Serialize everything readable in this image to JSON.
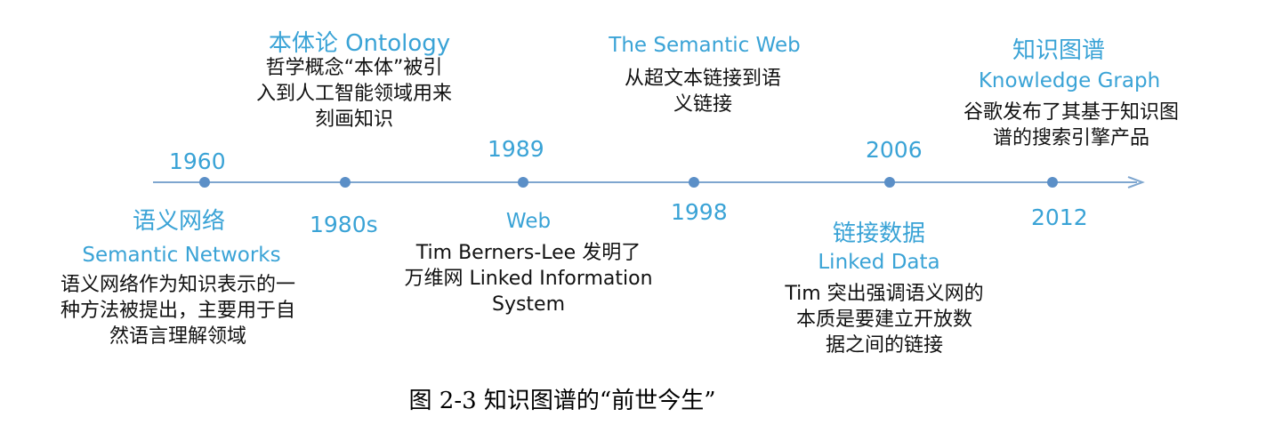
{
  "timeline": {
    "axis_color": "#7ea6cf",
    "dot_color": "#5b8fc7",
    "text_color": "#3aa3d6",
    "events": [
      {
        "year": "1960",
        "title_zh": "语义网络",
        "title_en": "Semantic Networks",
        "desc": [
          "语义网络作为知识表示的一",
          "种方法被提出，主要用于自",
          "然语言理解领域"
        ]
      },
      {
        "year": "1980s",
        "title_zh": "本体论 Ontology",
        "title_en": "",
        "desc": [
          "哲学概念“本体”被引",
          "入到人工智能领域用来",
          "刻画知识"
        ]
      },
      {
        "year": "1989",
        "title_zh": "",
        "title_en": "Web",
        "desc": [
          "Tim Berners-Lee 发明了",
          "万维网 Linked Information",
          "System"
        ]
      },
      {
        "year": "1998",
        "title_zh": "",
        "title_en": "The Semantic Web",
        "desc": [
          "从超文本链接到语",
          "义链接"
        ]
      },
      {
        "year": "2006",
        "title_zh": "链接数据",
        "title_en": "Linked Data",
        "desc": [
          "Tim 突出强调语义网的",
          "本质是要建立开放数",
          "据之间的链接"
        ]
      },
      {
        "year": "2012",
        "title_zh": "知识图谱",
        "title_en": "Knowledge Graph",
        "desc": [
          "谷歌发布了其基于知识图",
          "谱的搜索引擎产品"
        ]
      }
    ]
  },
  "caption": "图 2-3  知识图谱的“前世今生”"
}
